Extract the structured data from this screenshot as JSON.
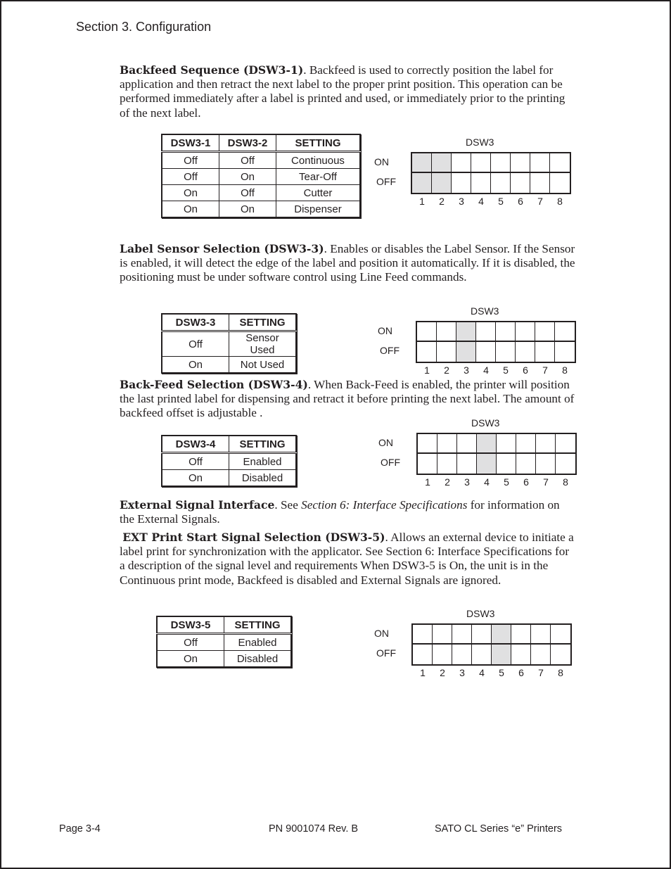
{
  "header": {
    "section": "Section 3.  Configuration"
  },
  "sections": {
    "backfeed_sequence": {
      "title": "Backfeed Sequence (DSW3-1)",
      "body": ". Backfeed is used to correctly position the label for application and then retract the next label to the proper print position. This operation can be performed immediately after a label is printed and used, or immediately prior to the printing of the next label.",
      "table": {
        "headers": [
          "DSW3-1",
          "DSW3-2",
          "SETTING"
        ],
        "rows": [
          [
            "Off",
            "Off",
            "Continuous"
          ],
          [
            "Off",
            "On",
            "Tear-Off"
          ],
          [
            "On",
            "Off",
            "Cutter"
          ],
          [
            "On",
            "On",
            "Dispenser"
          ]
        ]
      },
      "dip": {
        "title": "DSW3",
        "on_label": "ON",
        "off_label": "OFF",
        "highlighted_switches": [
          1,
          2
        ]
      }
    },
    "label_sensor": {
      "title": "Label Sensor Selection (DSW3-3)",
      "body": ". Enables or disables the Label Sensor. If the Sensor is enabled, it will detect the edge of the label and position it automatically. If it is disabled, the positioning must be under software control using Line Feed commands.",
      "table": {
        "headers": [
          "DSW3-3",
          "SETTING"
        ],
        "rows": [
          [
            "Off",
            "Sensor Used"
          ],
          [
            "On",
            "Not Used"
          ]
        ]
      },
      "dip": {
        "title": "DSW3",
        "on_label": "ON",
        "off_label": "OFF",
        "highlighted_switches": [
          3
        ]
      }
    },
    "back_feed_selection": {
      "title": "Back-Feed Selection (DSW3-4)",
      "body": ". When Back-Feed is enabled, the printer will position the last printed label for dispensing and retract it before printing the next label. The amount of backfeed offset is adjustable .",
      "table": {
        "headers": [
          "DSW3-4",
          "SETTING"
        ],
        "rows": [
          [
            "Off",
            "Enabled"
          ],
          [
            "On",
            "Disabled"
          ]
        ]
      },
      "dip": {
        "title": "DSW3",
        "on_label": "ON",
        "off_label": "OFF",
        "highlighted_switches": [
          4
        ]
      }
    },
    "external_signal": {
      "title": "External Signal Interface",
      "body_pre": ". See ",
      "body_italic": "Section 6: Interface Specifications",
      "body_post": " for information on the External Signals."
    },
    "ext_print_start": {
      "title": "EXT Print Start Signal Selection (DSW3-5)",
      "body": ". Allows an external device to initiate a label print for synchronization with the applicator. See Section 6: Interface Specifications for a description of the signal level and requirements When DSW3-5 is On, the unit is in the Continuous print mode, Backfeed is disabled and External Signals are ignored.",
      "table": {
        "headers": [
          "DSW3-5",
          "SETTING"
        ],
        "rows": [
          [
            "Off",
            "Enabled"
          ],
          [
            "On",
            "Disabled"
          ]
        ]
      },
      "dip": {
        "title": "DSW3",
        "on_label": "ON",
        "off_label": "OFF",
        "highlighted_switches": [
          5
        ]
      }
    }
  },
  "switch_numbers": [
    "1",
    "2",
    "3",
    "4",
    "5",
    "6",
    "7",
    "8"
  ],
  "colors": {
    "text": "#231f20",
    "highlight": "#e0e0e1"
  },
  "footer": {
    "page": "Page 3-4",
    "part_number": "PN 9001074 Rev. B",
    "product": "SATO CL Series “e” Printers"
  }
}
